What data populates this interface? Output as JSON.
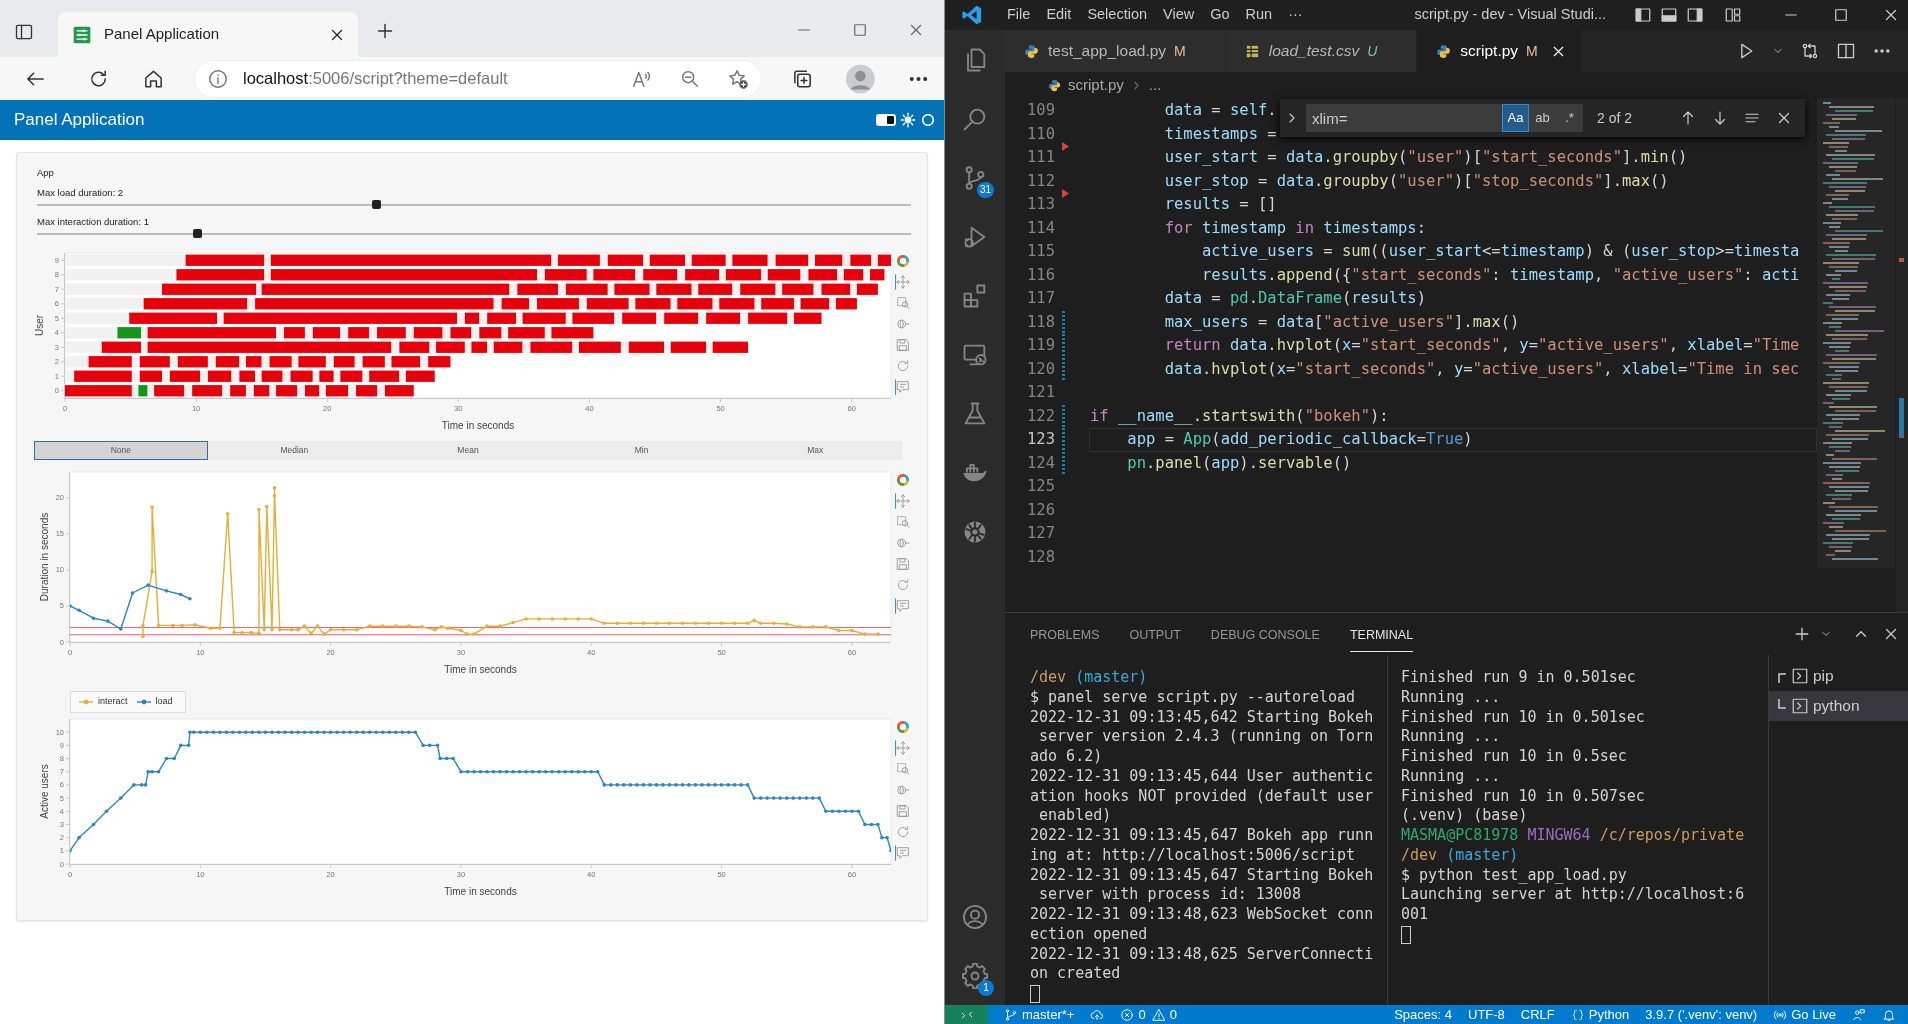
{
  "browser": {
    "tab": {
      "title": "Panel Application",
      "selected": true
    },
    "url": {
      "host": "localhost",
      "path": ":5006/script?theme=default"
    }
  },
  "panel": {
    "title": "Panel Application",
    "theme_switch": {
      "on": true
    },
    "section_title": "App",
    "sliders": [
      {
        "label": "Max load duration: 2",
        "level": 0.388
      },
      {
        "label": "Max interaction duration: 1",
        "level": 0.183
      }
    ],
    "timeline_chart": {
      "chart_data": {
        "type": "bar",
        "orientation": "horizontal",
        "stacked": true,
        "xlabel": "Time in seconds",
        "ylabel": "User",
        "xlim": [
          0,
          63
        ],
        "xticks": [
          0,
          10,
          20,
          30,
          40,
          50,
          60
        ],
        "categories": [
          "9",
          "8",
          "7",
          "6",
          "5",
          "4",
          "3",
          "2",
          "1",
          "0"
        ],
        "series": [
          {
            "values": [
              9.2,
              8.5,
              7.4,
              6.0,
              4.9,
              4.0,
              2.8,
              1.8,
              0.7,
              0
            ]
          },
          {
            "color": "#e5000b",
            "values": [
              6.0,
              6.7,
              7.2,
              7.9,
              6.7,
              0,
              3.0,
              3.3,
              4.4,
              5.1
            ]
          },
          {
            "color": "#13961b",
            "values": [
              0,
              0,
              0,
              0,
              0,
              1.8,
              0,
              0,
              0,
              0
            ]
          },
          {
            "values": [
              0.5,
              0.5,
              0.4,
              0.6,
              0.5,
              0.5,
              0.5,
              0.6,
              0.6,
              0.5
            ]
          },
          {
            "color": "#e5000b",
            "values": [
              21.4,
              20.3,
              18.9,
              18.2,
              17.8,
              9.8,
              18.6,
              2.3,
              1.7,
              0
            ]
          },
          {
            "color": "#13961b",
            "values": [
              0,
              0,
              0,
              0,
              0,
              0,
              0,
              0,
              0,
              0.7
            ]
          },
          {
            "values": [
              0.5,
              0.6,
              0.6,
              0.6,
              0.6,
              0.6,
              0.6,
              0.6,
              0.6,
              0.5
            ]
          },
          {
            "color": "#e5000b",
            "values": [
              3.2,
              3.2,
              3.1,
              2.1,
              1.1,
              1.6,
              2.3,
              2.3,
              2.3,
              2.3
            ]
          },
          {
            "values": [
              0.6,
              0.5,
              0.6,
              0.6,
              0.6,
              0.6,
              0.5,
              0.6,
              0.6,
              0.6
            ]
          },
          {
            "color": "#e5000b",
            "values": [
              2.7,
              3.2,
              3.2,
              3.2,
              2.2,
              2.1,
              2.2,
              1.8,
              1.8,
              2.3
            ]
          },
          {
            "values": [
              0.5,
              0.6,
              0.5,
              0.6,
              0.5,
              0.6,
              0.5,
              0.5,
              0.6,
              0.6
            ]
          },
          {
            "color": "#e5000b",
            "values": [
              2.7,
              2.6,
              2.7,
              3.2,
              3.3,
              1.6,
              1.2,
              1.2,
              1.2,
              1.2
            ]
          },
          {
            "values": [
              0.5,
              0.6,
              0.5,
              0.5,
              0.5,
              0.6,
              0.5,
              0.6,
              0.5,
              0.6
            ]
          },
          {
            "color": "#e5000b",
            "values": [
              2.6,
              2.6,
              2.7,
              2.7,
              3.2,
              2.2,
              2.2,
              1.7,
              1.6,
              1.2
            ]
          },
          {
            "values": [
              0.5,
              0.5,
              0.5,
              0.5,
              0.6,
              0.6,
              0.6,
              0.5,
              0.6,
              0.5
            ]
          },
          {
            "color": "#e5000b",
            "values": [
              2.7,
              2.7,
              2.6,
              2.7,
              2.6,
              2.2,
              3.2,
              2.1,
              1.7,
              1.6
            ]
          },
          {
            "values": [
              0.6,
              0.5,
              0.6,
              0.5,
              0.6,
              0.6,
              0.5,
              0.6,
              0.5,
              0.6
            ]
          },
          {
            "color": "#e5000b",
            "values": [
              2.5,
              2.5,
              2.7,
              2.7,
              2.6,
              1.6,
              3.2,
              1.6,
              1.1,
              1.1
            ]
          },
          {
            "values": [
              0.5,
              0.6,
              0.5,
              0.5,
              0.6,
              0.6,
              0.6,
              0.6,
              0.5,
              0.5
            ]
          },
          {
            "color": "#e5000b",
            "values": [
              2.1,
              2.2,
              2.4,
              2.5,
              2.6,
              1.7,
              2.7,
              1.7,
              1.7,
              1.7
            ]
          },
          {
            "values": [
              0.6,
              0.5,
              0.6,
              0.5,
              0.6,
              0.5,
              0.5,
              0.5,
              0.5,
              0.6
            ]
          },
          {
            "color": "#e5000b",
            "values": [
              1.6,
              1.5,
              2.2,
              2.2,
              3.0,
              2.8,
              2.7,
              2.2,
              2.3,
              1.6
            ]
          },
          {
            "values": [
              0.5,
              0.5,
              0.5,
              0.5,
              0.5,
              0.5,
              0.5,
              0.6,
              0.5,
              0.6
            ]
          },
          {
            "color": "#e5000b",
            "values": [
              1.0,
              1.1,
              1.6,
              1.6,
              2.1,
              3.2,
              2.7,
              1.7,
              2.2,
              2.2
            ]
          }
        ]
      },
      "toolbar": [
        {
          "kind": "logo",
          "active": false
        },
        {
          "kind": "pan",
          "active": true
        },
        {
          "kind": "box_zoom",
          "active": false
        },
        {
          "kind": "wheel_zoom",
          "active": false
        },
        {
          "kind": "save",
          "active": false
        },
        {
          "kind": "reset",
          "active": false
        },
        {
          "kind": "hover",
          "active": true
        }
      ]
    },
    "aggregation": [
      {
        "label": "None",
        "selected": true
      },
      {
        "label": "Median",
        "selected": false
      },
      {
        "label": "Mean",
        "selected": false
      },
      {
        "label": "Min",
        "selected": false
      },
      {
        "label": "Max",
        "selected": false
      }
    ],
    "duration_chart": {
      "chart_data": {
        "type": "line",
        "xlabel": "Time in seconds",
        "ylabel": "Duration in seconds",
        "xlim": [
          0,
          63
        ],
        "ylim": [
          0,
          23.6
        ],
        "xticks": [
          0,
          10,
          20,
          30,
          40,
          50,
          60
        ],
        "yticks": [
          0,
          5,
          10,
          15,
          20
        ],
        "series": [
          {
            "name": "interact",
            "color": "#e5ae38",
            "x": [
              5.6,
              5.6,
              6.3,
              6.3,
              6.8,
              7.9,
              8.6,
              9.6,
              10.8,
              11.5,
              12.1,
              12.6,
              13.2,
              13.9,
              14.5,
              14.5,
              14.9,
              15.1,
              15.5,
              15.7,
              15.7,
              16.1,
              17,
              17.5,
              18,
              18.5,
              19,
              19.5,
              20,
              21,
              22,
              23,
              24,
              25,
              26,
              27,
              28,
              28.5,
              29,
              30,
              30.5,
              31,
              32,
              33,
              34,
              35,
              36,
              37,
              38,
              39,
              40,
              41,
              42,
              43,
              44,
              45,
              46,
              47,
              48,
              49,
              50,
              51,
              52,
              52.5,
              53,
              54,
              55,
              56,
              57,
              58,
              59,
              60,
              61,
              62
            ],
            "values": [
              0.8,
              2.3,
              9.8,
              18.7,
              2.3,
              2.3,
              2.3,
              2.4,
              1.9,
              1.9,
              17.8,
              1.3,
              1.3,
              1.3,
              1.2,
              18.4,
              1.7,
              18.8,
              1.7,
              21.4,
              20.3,
              1.7,
              1.7,
              1.7,
              2.2,
              1.2,
              2.2,
              1.1,
              1.7,
              1.7,
              1.7,
              2.2,
              2.2,
              2.2,
              2.2,
              2.1,
              1.7,
              2.1,
              1.9,
              1.6,
              1.1,
              1.1,
              2.2,
              2.2,
              2.7,
              3.2,
              3.2,
              3.2,
              3.2,
              3.2,
              3.2,
              2.6,
              2.6,
              2.6,
              2.6,
              2.6,
              2.6,
              2.6,
              2.6,
              2.6,
              2.6,
              2.6,
              2.6,
              3.0,
              2.6,
              2.6,
              2.5,
              2.1,
              2.1,
              2.1,
              1.6,
              1.6,
              1.1,
              1.1
            ]
          },
          {
            "name": "load",
            "color": "#2c86c2",
            "x": [
              0,
              0.7,
              1.8,
              2.9,
              3.9,
              4.8,
              6.0,
              7.4,
              8.5,
              9.2
            ],
            "values": [
              5.0,
              4.4,
              3.3,
              2.9,
              1.8,
              6.8,
              7.9,
              7.1,
              6.6,
              6.0
            ]
          }
        ],
        "ref_lines": [
          {
            "axis": "y",
            "value": 1
          },
          {
            "axis": "y",
            "value": 2
          }
        ]
      },
      "toolbar": [
        {
          "kind": "logo",
          "active": false
        },
        {
          "kind": "pan",
          "active": true
        },
        {
          "kind": "box_zoom",
          "active": false
        },
        {
          "kind": "wheel_zoom",
          "active": false
        },
        {
          "kind": "save",
          "active": false
        },
        {
          "kind": "reset",
          "active": false
        },
        {
          "kind": "hover",
          "active": true
        }
      ]
    },
    "users_chart": {
      "chart_data": {
        "type": "line",
        "xlabel": "Time in seconds",
        "ylabel": "Active users",
        "xlim": [
          0,
          63
        ],
        "ylim": [
          0,
          11
        ],
        "xticks": [
          0,
          10,
          20,
          30,
          40,
          50,
          60
        ],
        "yticks": [
          0,
          1,
          2,
          3,
          4,
          5,
          6,
          7,
          8,
          9,
          10
        ],
        "series": [
          {
            "color": "#2c86c2",
            "x": [
              0,
              0.7,
              1.8,
              2.8,
              3.9,
              4.9,
              5.5,
              5.8,
              6.0,
              6.3,
              6.8,
              7.4,
              8.0,
              8.5,
              9.1,
              9.2,
              9.5,
              10,
              10.5,
              11,
              11.5,
              12,
              12.5,
              13,
              13.5,
              14,
              14.5,
              15,
              15.5,
              16,
              16.5,
              17,
              17.5,
              18,
              18.5,
              19,
              19.5,
              20,
              20.5,
              21,
              21.5,
              22,
              22.5,
              23,
              23.5,
              24,
              24.5,
              25,
              25.5,
              26,
              26.5,
              27.1,
              27.6,
              28.2,
              28.4,
              28.9,
              29.4,
              30,
              30.5,
              31,
              31.5,
              32,
              32.5,
              33,
              33.5,
              34,
              34.5,
              35,
              35.5,
              36,
              36.5,
              37,
              37.5,
              38,
              38.5,
              39,
              39.5,
              40,
              40.5,
              41,
              41.5,
              42,
              42.5,
              43,
              43.5,
              44,
              44.5,
              45,
              45.5,
              46,
              46.5,
              47,
              47.5,
              48,
              48.5,
              49,
              49.5,
              50,
              50.5,
              51,
              51.5,
              52,
              52.5,
              53,
              53.5,
              54,
              54.5,
              55,
              55.5,
              56,
              56.5,
              57,
              57.5,
              58,
              58.5,
              59,
              59.5,
              60,
              60.5,
              61,
              61.5,
              62,
              62.3,
              62.7,
              63
            ],
            "values": [
              1,
              2,
              3,
              4,
              5,
              6,
              6,
              6,
              7,
              7,
              7,
              8,
              8,
              9,
              9,
              10,
              10,
              10,
              10,
              10,
              10,
              10,
              10,
              10,
              10,
              10,
              10,
              10,
              10,
              10,
              10,
              10,
              10,
              10,
              10,
              10,
              10,
              10,
              10,
              10,
              10,
              10,
              10,
              10,
              10,
              10,
              10,
              10,
              10,
              10,
              10,
              9,
              9,
              9,
              8,
              8,
              8,
              7,
              7,
              7,
              7,
              7,
              7,
              7,
              7,
              7,
              7,
              7,
              7,
              7,
              7,
              7,
              7,
              7,
              7,
              7,
              7,
              7,
              7,
              6,
              6,
              6,
              6,
              6,
              6,
              6,
              6,
              6,
              6,
              6,
              6,
              6,
              6,
              6,
              6,
              6,
              6,
              6,
              6,
              6,
              6,
              6,
              5,
              5,
              5,
              5,
              5,
              5,
              5,
              5,
              5,
              5,
              5,
              4,
              4,
              4,
              4,
              4,
              4,
              3,
              3,
              3,
              2,
              2,
              1
            ]
          }
        ]
      },
      "toolbar": [
        {
          "kind": "logo",
          "active": false
        },
        {
          "kind": "pan",
          "active": true
        },
        {
          "kind": "box_zoom",
          "active": false
        },
        {
          "kind": "wheel_zoom",
          "active": false
        },
        {
          "kind": "save",
          "active": false
        },
        {
          "kind": "reset",
          "active": false
        },
        {
          "kind": "hover",
          "active": true
        }
      ]
    }
  },
  "vscode": {
    "menu": [
      "File",
      "Edit",
      "Selection",
      "View",
      "Go",
      "Run",
      "···"
    ],
    "title": "script.py - dev - Visual Studi...",
    "activity": [
      {
        "kind": "explorer"
      },
      {
        "kind": "search"
      },
      {
        "kind": "source_control",
        "badge": "31"
      },
      {
        "kind": "run"
      },
      {
        "kind": "extensions"
      },
      {
        "kind": "remote"
      },
      {
        "kind": "testing"
      },
      {
        "kind": "docker"
      },
      {
        "kind": "kubernetes"
      }
    ],
    "activity_bottom": [
      {
        "kind": "account"
      },
      {
        "kind": "settings",
        "badge": "1"
      }
    ],
    "tabs": [
      {
        "label": "test_app_load.py",
        "status": "M",
        "kind": "python",
        "selected": false,
        "preview": false
      },
      {
        "label": "load_test.csv",
        "status": "U",
        "kind": "csv",
        "selected": false,
        "preview": true
      },
      {
        "label": "script.py",
        "status": "M",
        "kind": "python",
        "selected": true,
        "preview": false
      }
    ],
    "breadcrumb": [
      "script.py",
      "..."
    ],
    "find": {
      "value": "xlim=",
      "options": [
        {
          "label": "Aa",
          "on": true
        },
        {
          "label": "ab",
          "on": false
        },
        {
          "label": ".*",
          "on": false
        }
      ],
      "result": "2 of 2"
    },
    "lines": [
      {
        "number": "109",
        "current": false,
        "tokens": [
          {
            "text": "        data",
            "kind": "var"
          },
          {
            "text": " = ",
            "kind": "plain"
          },
          {
            "text": "self",
            "kind": "var"
          },
          {
            "text": ".",
            "kind": "plain"
          }
        ]
      },
      {
        "number": "110",
        "current": false,
        "deleted": true,
        "tokens": [
          {
            "text": "        timestamps",
            "kind": "var"
          },
          {
            "text": " =",
            "kind": "plain"
          }
        ]
      },
      {
        "number": "111",
        "current": false,
        "tokens": [
          {
            "text": "        user_start",
            "kind": "var"
          },
          {
            "text": " = ",
            "kind": "plain"
          },
          {
            "text": "data",
            "kind": "var"
          },
          {
            "text": ".",
            "kind": "plain"
          },
          {
            "text": "groupby",
            "kind": "fn"
          },
          {
            "text": "(",
            "kind": "plain"
          },
          {
            "text": "\"user\"",
            "kind": "str"
          },
          {
            "text": ")[",
            "kind": "plain"
          },
          {
            "text": "\"start_seconds\"",
            "kind": "str"
          },
          {
            "text": "].",
            "kind": "plain"
          },
          {
            "text": "min",
            "kind": "fn"
          },
          {
            "text": "()",
            "kind": "plain"
          }
        ]
      },
      {
        "number": "112",
        "current": false,
        "deleted": true,
        "tokens": [
          {
            "text": "        user_stop",
            "kind": "var"
          },
          {
            "text": " = ",
            "kind": "plain"
          },
          {
            "text": "data",
            "kind": "var"
          },
          {
            "text": ".",
            "kind": "plain"
          },
          {
            "text": "groupby",
            "kind": "fn"
          },
          {
            "text": "(",
            "kind": "plain"
          },
          {
            "text": "\"user\"",
            "kind": "str"
          },
          {
            "text": ")[",
            "kind": "plain"
          },
          {
            "text": "\"stop_seconds\"",
            "kind": "str"
          },
          {
            "text": "].",
            "kind": "plain"
          },
          {
            "text": "max",
            "kind": "fn"
          },
          {
            "text": "()",
            "kind": "plain"
          }
        ]
      },
      {
        "number": "113",
        "current": false,
        "tokens": [
          {
            "text": "        results",
            "kind": "var"
          },
          {
            "text": " = []",
            "kind": "plain"
          }
        ]
      },
      {
        "number": "114",
        "current": false,
        "tokens": [
          {
            "text": "        for ",
            "kind": "kw"
          },
          {
            "text": "timestamp ",
            "kind": "var"
          },
          {
            "text": "in ",
            "kind": "kw"
          },
          {
            "text": "timestamps",
            "kind": "var"
          },
          {
            "text": ":",
            "kind": "plain"
          }
        ]
      },
      {
        "number": "115",
        "current": false,
        "tokens": [
          {
            "text": "            active_users",
            "kind": "var"
          },
          {
            "text": " = ",
            "kind": "plain"
          },
          {
            "text": "sum",
            "kind": "fn"
          },
          {
            "text": "((",
            "kind": "plain"
          },
          {
            "text": "user_start",
            "kind": "var"
          },
          {
            "text": "<=",
            "kind": "plain"
          },
          {
            "text": "timestamp",
            "kind": "var"
          },
          {
            "text": ") & (",
            "kind": "plain"
          },
          {
            "text": "user_stop",
            "kind": "var"
          },
          {
            "text": ">=",
            "kind": "plain"
          },
          {
            "text": "timesta",
            "kind": "var"
          }
        ]
      },
      {
        "number": "116",
        "current": false,
        "tokens": [
          {
            "text": "            results",
            "kind": "var"
          },
          {
            "text": ".",
            "kind": "plain"
          },
          {
            "text": "append",
            "kind": "fn"
          },
          {
            "text": "({",
            "kind": "plain"
          },
          {
            "text": "\"start_seconds\"",
            "kind": "str"
          },
          {
            "text": ": ",
            "kind": "plain"
          },
          {
            "text": "timestamp",
            "kind": "var"
          },
          {
            "text": ", ",
            "kind": "plain"
          },
          {
            "text": "\"active_users\"",
            "kind": "str"
          },
          {
            "text": ": ",
            "kind": "plain"
          },
          {
            "text": "acti",
            "kind": "var"
          }
        ]
      },
      {
        "number": "117",
        "current": false,
        "tokens": [
          {
            "text": "        data",
            "kind": "var"
          },
          {
            "text": " = ",
            "kind": "plain"
          },
          {
            "text": "pd",
            "kind": "cls"
          },
          {
            "text": ".",
            "kind": "plain"
          },
          {
            "text": "DataFrame",
            "kind": "cls"
          },
          {
            "text": "(",
            "kind": "plain"
          },
          {
            "text": "results",
            "kind": "var"
          },
          {
            "text": ")",
            "kind": "plain"
          }
        ]
      },
      {
        "number": "118",
        "current": false,
        "modified": true,
        "tokens": [
          {
            "text": "        max_users",
            "kind": "var"
          },
          {
            "text": " = ",
            "kind": "plain"
          },
          {
            "text": "data",
            "kind": "var"
          },
          {
            "text": "[",
            "kind": "plain"
          },
          {
            "text": "\"active_users\"",
            "kind": "str"
          },
          {
            "text": "].",
            "kind": "plain"
          },
          {
            "text": "max",
            "kind": "fn"
          },
          {
            "text": "()",
            "kind": "plain"
          }
        ]
      },
      {
        "number": "119",
        "current": false,
        "modified": true,
        "tokens": [
          {
            "text": "        return ",
            "kind": "kw"
          },
          {
            "text": "data",
            "kind": "var"
          },
          {
            "text": ".",
            "kind": "plain"
          },
          {
            "text": "hvplot",
            "kind": "fn"
          },
          {
            "text": "(",
            "kind": "plain"
          },
          {
            "text": "x",
            "kind": "var"
          },
          {
            "text": "=",
            "kind": "plain"
          },
          {
            "text": "\"start_seconds\"",
            "kind": "str"
          },
          {
            "text": ", ",
            "kind": "plain"
          },
          {
            "text": "y",
            "kind": "var"
          },
          {
            "text": "=",
            "kind": "plain"
          },
          {
            "text": "\"active_users\"",
            "kind": "str"
          },
          {
            "text": ", ",
            "kind": "plain"
          },
          {
            "text": "xlabel",
            "kind": "var"
          },
          {
            "text": "=",
            "kind": "plain"
          },
          {
            "text": "\"Time",
            "kind": "str"
          }
        ]
      },
      {
        "number": "120",
        "current": false,
        "modified": true,
        "tokens": [
          {
            "text": "        data",
            "kind": "var"
          },
          {
            "text": ".",
            "kind": "plain"
          },
          {
            "text": "hvplot",
            "kind": "fn"
          },
          {
            "text": "(",
            "kind": "plain"
          },
          {
            "text": "x",
            "kind": "var"
          },
          {
            "text": "=",
            "kind": "plain"
          },
          {
            "text": "\"start_seconds\"",
            "kind": "str"
          },
          {
            "text": ", ",
            "kind": "plain"
          },
          {
            "text": "y",
            "kind": "var"
          },
          {
            "text": "=",
            "kind": "plain"
          },
          {
            "text": "\"active_users\"",
            "kind": "str"
          },
          {
            "text": ", ",
            "kind": "plain"
          },
          {
            "text": "xlabel",
            "kind": "var"
          },
          {
            "text": "=",
            "kind": "plain"
          },
          {
            "text": "\"Time in sec",
            "kind": "str"
          }
        ]
      },
      {
        "number": "121",
        "current": false
      },
      {
        "number": "122",
        "current": false,
        "modified": true,
        "tokens": [
          {
            "text": "if ",
            "kind": "kw"
          },
          {
            "text": "__name__",
            "kind": "var"
          },
          {
            "text": ".",
            "kind": "plain"
          },
          {
            "text": "startswith",
            "kind": "fn"
          },
          {
            "text": "(",
            "kind": "plain"
          },
          {
            "text": "\"bokeh\"",
            "kind": "str"
          },
          {
            "text": "):",
            "kind": "plain"
          }
        ]
      },
      {
        "number": "123",
        "current": true,
        "modified": true,
        "tokens": [
          {
            "text": "    app",
            "kind": "var"
          },
          {
            "text": " = ",
            "kind": "plain"
          },
          {
            "text": "App",
            "kind": "cls"
          },
          {
            "text": "(",
            "kind": "plain"
          },
          {
            "text": "add_periodic_callback",
            "kind": "var"
          },
          {
            "text": "=",
            "kind": "plain"
          },
          {
            "text": "True",
            "kind": "const"
          },
          {
            "text": ")",
            "kind": "plain"
          }
        ]
      },
      {
        "number": "124",
        "current": false,
        "modified": true,
        "tokens": [
          {
            "text": "    pn",
            "kind": "cls"
          },
          {
            "text": ".",
            "kind": "plain"
          },
          {
            "text": "panel",
            "kind": "fn"
          },
          {
            "text": "(",
            "kind": "plain"
          },
          {
            "text": "app",
            "kind": "var"
          },
          {
            "text": ").",
            "kind": "plain"
          },
          {
            "text": "servable",
            "kind": "fn"
          },
          {
            "text": "()",
            "kind": "plain"
          }
        ]
      },
      {
        "number": "125",
        "current": false
      },
      {
        "number": "126",
        "current": false
      },
      {
        "number": "127",
        "current": false
      },
      {
        "number": "128",
        "current": false
      }
    ],
    "panel_tabs": [
      {
        "label": "PROBLEMS",
        "selected": false
      },
      {
        "label": "OUTPUT",
        "selected": false
      },
      {
        "label": "DEBUG CONSOLE",
        "selected": false
      },
      {
        "label": "TERMINAL",
        "selected": true
      }
    ],
    "terminal_left": [
      [
        {
          "text": "/dev ",
          "kind": "path"
        },
        {
          "text": "(master)",
          "kind": "branch"
        }
      ],
      [
        {
          "text": "$ panel serve script.py --autoreload",
          "kind": "plain"
        }
      ],
      [
        {
          "text": "2022-12-31 09:13:45,642 Starting Bokeh",
          "kind": "plain"
        }
      ],
      [
        {
          "text": " server version 2.4.3 (running on Torn",
          "kind": "plain"
        }
      ],
      [
        {
          "text": "ado 6.2)",
          "kind": "plain"
        }
      ],
      [
        {
          "text": "2022-12-31 09:13:45,644 User authentic",
          "kind": "plain"
        }
      ],
      [
        {
          "text": "ation hooks NOT provided (default user",
          "kind": "plain"
        }
      ],
      [
        {
          "text": " enabled)",
          "kind": "plain"
        }
      ],
      [
        {
          "text": "2022-12-31 09:13:45,647 Bokeh app runn",
          "kind": "plain"
        }
      ],
      [
        {
          "text": "ing at: http://localhost:5006/script",
          "kind": "plain"
        }
      ],
      [
        {
          "text": "2022-12-31 09:13:45,647 Starting Bokeh",
          "kind": "plain"
        }
      ],
      [
        {
          "text": " server with process id: 13008",
          "kind": "plain"
        }
      ],
      [
        {
          "text": "2022-12-31 09:13:48,623 WebSocket conn",
          "kind": "plain"
        }
      ],
      [
        {
          "text": "ection opened",
          "kind": "plain"
        }
      ],
      [
        {
          "text": "2022-12-31 09:13:48,625 ServerConnecti",
          "kind": "plain"
        }
      ],
      [
        {
          "text": "on created",
          "kind": "plain"
        }
      ]
    ],
    "terminal_right": [
      [
        {
          "text": "Finished run 9 in 0.501sec",
          "kind": "plain"
        }
      ],
      [
        {
          "text": "Running ...",
          "kind": "plain"
        }
      ],
      [
        {
          "text": "Finished run 10 in 0.501sec",
          "kind": "plain"
        }
      ],
      [
        {
          "text": "Running ...",
          "kind": "plain"
        }
      ],
      [
        {
          "text": "Finished run 10 in 0.5sec",
          "kind": "plain"
        }
      ],
      [
        {
          "text": "Running ...",
          "kind": "plain"
        }
      ],
      [
        {
          "text": "Finished run 10 in 0.507sec",
          "kind": "plain"
        }
      ],
      [
        {
          "text": "(.venv) (base)",
          "kind": "plain"
        }
      ],
      [
        {
          "text": "MASMA@PC81978 ",
          "kind": "user"
        },
        {
          "text": "MINGW64 ",
          "kind": "host"
        },
        {
          "text": "/c/repos/private",
          "kind": "path"
        }
      ],
      [
        {
          "text": "/dev ",
          "kind": "path"
        },
        {
          "text": "(master)",
          "kind": "branch"
        }
      ],
      [
        {
          "text": "$ python test_app_load.py",
          "kind": "plain"
        }
      ],
      [
        {
          "text": "Launching server at http://localhost:6",
          "kind": "plain"
        }
      ],
      [
        {
          "text": "001",
          "kind": "plain"
        }
      ]
    ],
    "terminals": [
      {
        "label": "pip",
        "selected": false
      },
      {
        "label": "python",
        "selected": true
      }
    ],
    "status_left": [
      {
        "kind": "remote"
      },
      {
        "kind": "branch",
        "label": "master*+"
      },
      {
        "kind": "sync"
      },
      {
        "kind": "errors",
        "label": "0"
      },
      {
        "kind": "warnings",
        "label": "0"
      }
    ],
    "status_right": [
      {
        "kind": "text",
        "label": "Spaces: 4"
      },
      {
        "kind": "text",
        "label": "UTF-8"
      },
      {
        "kind": "text",
        "label": "CRLF"
      },
      {
        "kind": "language",
        "label": "Python"
      },
      {
        "kind": "text",
        "label": "3.9.7 ('.venv': venv)"
      },
      {
        "kind": "golive",
        "label": "Go Live"
      },
      {
        "kind": "feedback"
      },
      {
        "kind": "bell"
      }
    ]
  }
}
